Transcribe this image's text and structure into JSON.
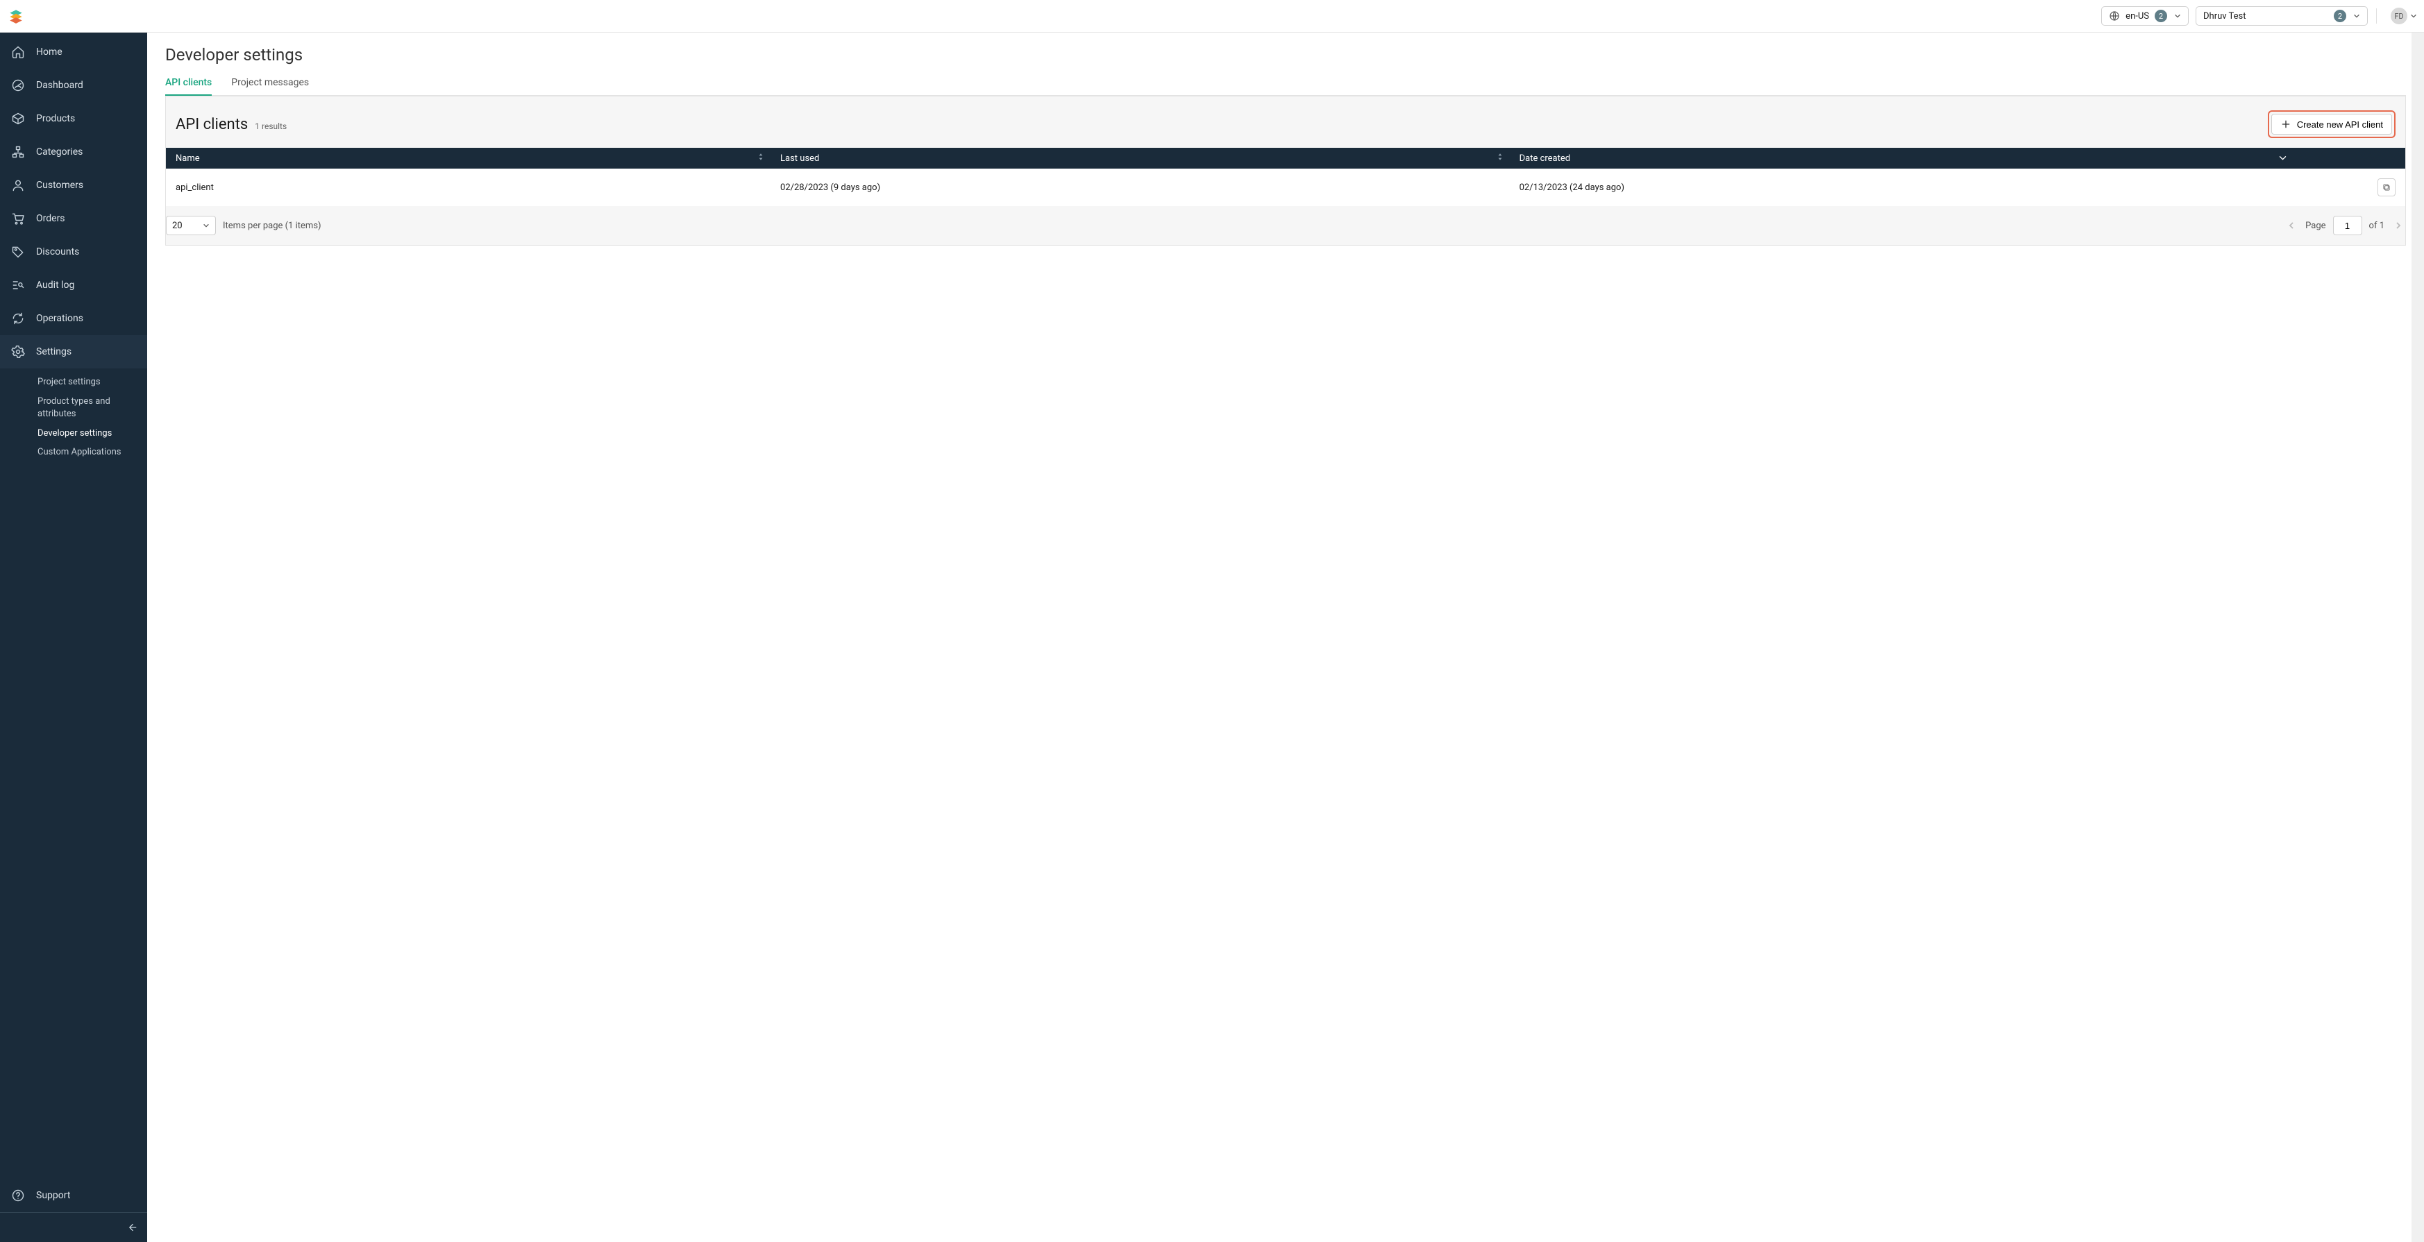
{
  "header": {
    "locale": {
      "label": "en-US",
      "badge": "2"
    },
    "project": {
      "label": "Dhruv Test",
      "badge": "2"
    },
    "avatar": "FD"
  },
  "sidebar": {
    "items": [
      {
        "label": "Home"
      },
      {
        "label": "Dashboard"
      },
      {
        "label": "Products"
      },
      {
        "label": "Categories"
      },
      {
        "label": "Customers"
      },
      {
        "label": "Orders"
      },
      {
        "label": "Discounts"
      },
      {
        "label": "Audit log"
      },
      {
        "label": "Operations"
      },
      {
        "label": "Settings"
      }
    ],
    "settings_sub": [
      {
        "label": "Project settings"
      },
      {
        "label": "Product types and attributes"
      },
      {
        "label": "Developer settings"
      },
      {
        "label": "Custom Applications"
      }
    ],
    "support": "Support"
  },
  "page": {
    "title": "Developer settings",
    "tabs": {
      "api_clients": "API clients",
      "project_messages": "Project messages"
    }
  },
  "panel": {
    "title": "API clients",
    "count_prefix": "1",
    "count_suffix": "results",
    "create_button": "Create new API client"
  },
  "table": {
    "columns": {
      "name": "Name",
      "last_used": "Last used",
      "date_created": "Date created"
    },
    "rows": [
      {
        "name": "api_client",
        "last_used": "02/28/2023 (9 days ago)",
        "date_created": "02/13/2023 (24 days ago)"
      }
    ]
  },
  "footer": {
    "per_page": "20",
    "items_text": "Items per page (1 items)",
    "page_label": "Page",
    "page_value": "1",
    "of_text": "of 1"
  }
}
